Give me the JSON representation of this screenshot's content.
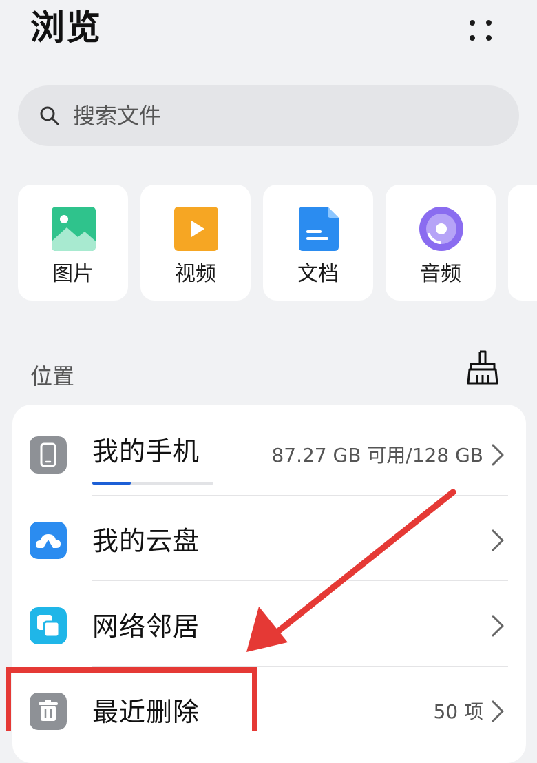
{
  "header": {
    "title": "浏览",
    "more_icon": "more-vertical-dots-icon"
  },
  "search": {
    "placeholder": "搜索文件",
    "icon": "search-icon"
  },
  "categories": [
    {
      "label": "图片",
      "icon": "image-icon",
      "color": "#2fc38c"
    },
    {
      "label": "视频",
      "icon": "video-icon",
      "color": "#f6a623"
    },
    {
      "label": "文档",
      "icon": "document-icon",
      "color": "#2b8cf0"
    },
    {
      "label": "音频",
      "icon": "audio-icon",
      "color": "#8a6cf0"
    }
  ],
  "locations": {
    "title": "位置",
    "clean_icon": "broom-icon",
    "items": [
      {
        "label": "我的手机",
        "detail": "87.27 GB 可用/128 GB",
        "icon": "phone-icon",
        "color": "#8e9196",
        "used_fraction": 0.32
      },
      {
        "label": "我的云盘",
        "detail": "",
        "icon": "cloud-icon",
        "color": "#2b8cf0"
      },
      {
        "label": "网络邻居",
        "detail": "",
        "icon": "network-icon",
        "color": "#1fb6e8"
      },
      {
        "label": "最近删除",
        "detail": "50 项",
        "icon": "trash-icon",
        "color": "#8e9196"
      }
    ]
  },
  "colors": {
    "background": "#f1f2f4",
    "card": "#ffffff",
    "accent": "#1c5fd6",
    "annotation": "#e53935"
  }
}
